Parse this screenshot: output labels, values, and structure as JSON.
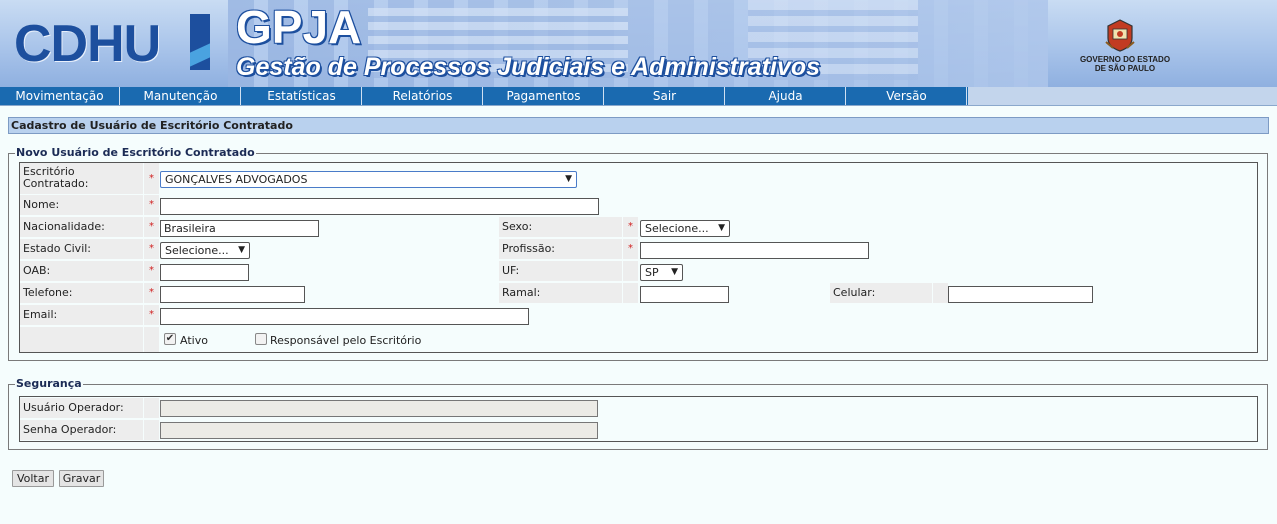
{
  "header": {
    "logo_cdhu": "CDHU",
    "logo_gpja": "GPJA",
    "subtitle": "Gestão de Processos Judiciais e Administrativos",
    "gov_line1": "GOVERNO DO ESTADO",
    "gov_line2": "DE SÃO PAULO",
    "brand_color": "#1d4f9e"
  },
  "menu": {
    "items": [
      "Movimentação",
      "Manutenção",
      "Estatísticas",
      "Relatórios",
      "Pagamentos",
      "Sair",
      "Ajuda",
      "Versão"
    ],
    "color": "#1a6ab0"
  },
  "page_title": "Cadastro de Usuário de Escritório Contratado",
  "novo_usuario": {
    "legend": "Novo Usuário de Escritório Contratado",
    "escritorio_label_1": "Escritório",
    "escritorio_label_2": "Contratado:",
    "escritorio_value": "GONÇALVES ADVOGADOS",
    "nome_label": "Nome:",
    "nome_value": "",
    "nacionalidade_label": "Nacionalidade:",
    "nacionalidade_value": "Brasileira",
    "sexo_label": "Sexo:",
    "sexo_value": "Selecione...",
    "estado_civil_label": "Estado Civil:",
    "estado_civil_value": "Selecione...",
    "profissao_label": "Profissão:",
    "profissao_value": "",
    "oab_label": "OAB:",
    "oab_value": "",
    "uf_label": "UF:",
    "uf_value": "SP",
    "telefone_label": "Telefone:",
    "telefone_value": "",
    "ramal_label": "Ramal:",
    "ramal_value": "",
    "celular_label": "Celular:",
    "celular_value": "",
    "email_label": "Email:",
    "email_value": "",
    "ativo_label": "Ativo",
    "ativo_checked": "✔",
    "responsavel_label": "Responsável pelo Escritório",
    "required_mark": "*"
  },
  "seguranca": {
    "legend": "Segurança",
    "usuario_label": "Usuário Operador:",
    "usuario_value": "",
    "senha_label": "Senha Operador:",
    "senha_value": ""
  },
  "buttons": {
    "voltar": "Voltar",
    "gravar": "Gravar"
  }
}
